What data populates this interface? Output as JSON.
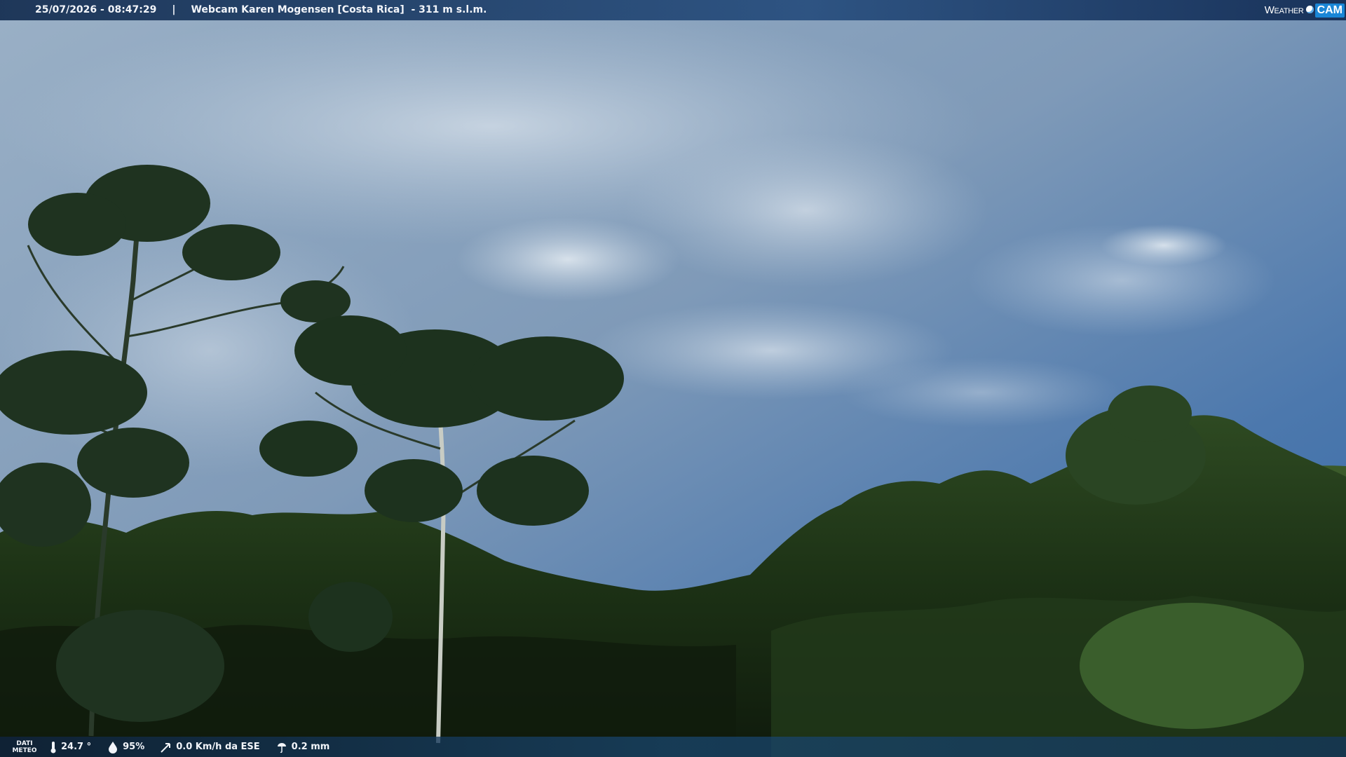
{
  "header": {
    "datetime": "25/07/2026 - 08:47:29",
    "separator": "|",
    "camera_title": "Webcam Karen Mogensen [Costa Rica]  - 311 m s.l.m.",
    "logo_word": "Weather",
    "logo_cam": "CAM"
  },
  "weather": {
    "label_line1": "DATI",
    "label_line2": "METEO",
    "temperature": "24.7 °",
    "humidity": "95%",
    "wind": "0.0 Km/h da ESE",
    "rain": "0.2 mm"
  },
  "colors": {
    "sky_top": "#8fa6bd",
    "sky_blue": "#3f6fa8",
    "foliage_dark": "#14230f",
    "foliage_mid": "#2c4a1e",
    "bar": "#1d4a78"
  }
}
